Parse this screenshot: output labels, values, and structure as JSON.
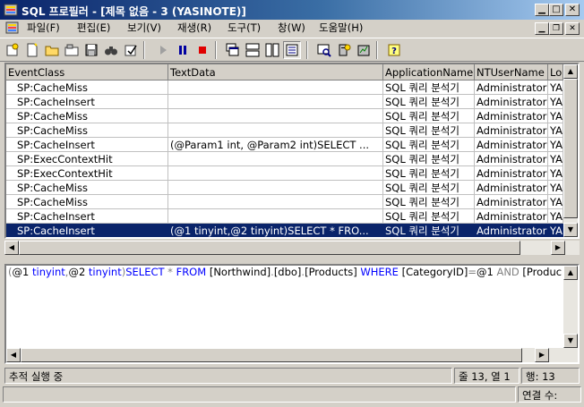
{
  "window": {
    "title": "SQL 프로필러 - [제목 없음 - 3 (YASINOTE)]"
  },
  "menu": [
    {
      "label": "파일(F)"
    },
    {
      "label": "편집(E)"
    },
    {
      "label": "보기(V)"
    },
    {
      "label": "재생(R)"
    },
    {
      "label": "도구(T)"
    },
    {
      "label": "창(W)"
    },
    {
      "label": "도움말(H)"
    }
  ],
  "grid": {
    "columns": [
      "EventClass",
      "TextData",
      "ApplicationName",
      "NTUserName",
      "Lo"
    ],
    "rows": [
      {
        "event": "SP:CacheMiss",
        "text": "",
        "app": "SQL 쿼리 분석기",
        "user": "Administrator",
        "lo": "YA"
      },
      {
        "event": "SP:CacheInsert",
        "text": "",
        "app": "SQL 쿼리 분석기",
        "user": "Administrator",
        "lo": "YA"
      },
      {
        "event": "SP:CacheMiss",
        "text": "",
        "app": "SQL 쿼리 분석기",
        "user": "Administrator",
        "lo": "YA"
      },
      {
        "event": "SP:CacheMiss",
        "text": "",
        "app": "SQL 쿼리 분석기",
        "user": "Administrator",
        "lo": "YA"
      },
      {
        "event": "SP:CacheInsert",
        "text": "(@Param1 int, @Param2 int)SELECT ...",
        "app": "SQL 쿼리 분석기",
        "user": "Administrator",
        "lo": "YA"
      },
      {
        "event": "SP:ExecContextHit",
        "text": "",
        "app": "SQL 쿼리 분석기",
        "user": "Administrator",
        "lo": "YA"
      },
      {
        "event": "SP:ExecContextHit",
        "text": "",
        "app": "SQL 쿼리 분석기",
        "user": "Administrator",
        "lo": "YA"
      },
      {
        "event": "SP:CacheMiss",
        "text": "",
        "app": "SQL 쿼리 분석기",
        "user": "Administrator",
        "lo": "YA"
      },
      {
        "event": "SP:CacheMiss",
        "text": "",
        "app": "SQL 쿼리 분석기",
        "user": "Administrator",
        "lo": "YA"
      },
      {
        "event": "SP:CacheInsert",
        "text": "",
        "app": "SQL 쿼리 분석기",
        "user": "Administrator",
        "lo": "YA"
      },
      {
        "event": "SP:CacheInsert",
        "text": "(@1 tinyint,@2 tinyint)SELECT * FRO...",
        "app": "SQL 쿼리 분석기",
        "user": "Administrator",
        "lo": "YA",
        "selected": true
      }
    ]
  },
  "sql_panel": {
    "tokens": [
      {
        "t": "(",
        "c": "op"
      },
      {
        "t": "@1 ",
        "c": "plain"
      },
      {
        "t": "tinyint",
        "c": "kw"
      },
      {
        "t": ",",
        "c": "op"
      },
      {
        "t": "@2 ",
        "c": "plain"
      },
      {
        "t": "tinyint",
        "c": "kw"
      },
      {
        "t": ")",
        "c": "op"
      },
      {
        "t": "SELECT",
        "c": "kw"
      },
      {
        "t": " * ",
        "c": "op"
      },
      {
        "t": "FROM",
        "c": "kw"
      },
      {
        "t": " [Northwind]",
        "c": "plain"
      },
      {
        "t": ".",
        "c": "op"
      },
      {
        "t": "[dbo]",
        "c": "plain"
      },
      {
        "t": ".",
        "c": "op"
      },
      {
        "t": "[Products] ",
        "c": "plain"
      },
      {
        "t": "WHERE",
        "c": "kw"
      },
      {
        "t": " [CategoryID]",
        "c": "plain"
      },
      {
        "t": "=",
        "c": "op"
      },
      {
        "t": "@1 ",
        "c": "plain"
      },
      {
        "t": "AND",
        "c": "op"
      },
      {
        "t": " [Produc",
        "c": "plain"
      }
    ]
  },
  "status": {
    "message": "추적 실행 중",
    "position": "줄 13, 열 1",
    "rows": "행: 13",
    "connections": "연결 수:"
  },
  "colors": {
    "selection": "#0a246a",
    "keyword": "#0000ff",
    "face": "#d4d0c8"
  }
}
